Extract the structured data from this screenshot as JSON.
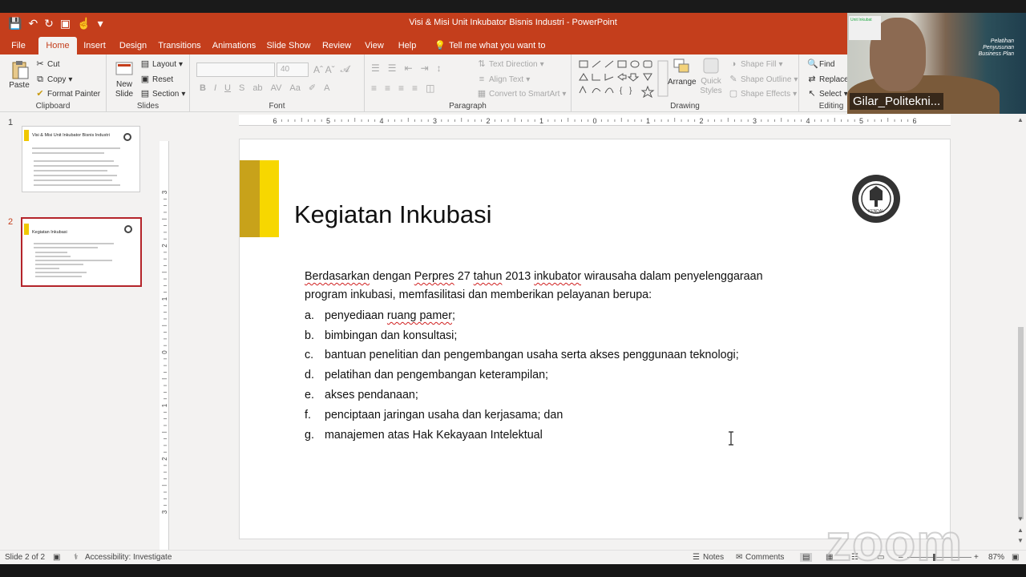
{
  "window": {
    "title": "Visi & Misi Unit Inkubator Bisnis Industri  -  PowerPoint"
  },
  "tabs": [
    {
      "label": "File"
    },
    {
      "label": "Home"
    },
    {
      "label": "Insert"
    },
    {
      "label": "Design"
    },
    {
      "label": "Transitions"
    },
    {
      "label": "Animations"
    },
    {
      "label": "Slide Show"
    },
    {
      "label": "Review"
    },
    {
      "label": "View"
    },
    {
      "label": "Help"
    }
  ],
  "tell_me": "Tell me what you want to do",
  "ribbon": {
    "clipboard": {
      "paste": "Paste",
      "cut": "Cut",
      "copy": "Copy",
      "format_painter": "Format Painter",
      "label": "Clipboard"
    },
    "slides": {
      "new_slide": "New",
      "new_slide2": "Slide",
      "layout": "Layout",
      "reset": "Reset",
      "section": "Section",
      "label": "Slides"
    },
    "font": {
      "size": "40",
      "label": "Font"
    },
    "paragraph": {
      "text_direction": "Text Direction",
      "align_text": "Align Text",
      "convert_smartart": "Convert to SmartArt",
      "label": "Paragraph"
    },
    "drawing": {
      "arrange": "Arrange",
      "quick_styles": "Quick",
      "quick_styles2": "Styles",
      "shape_fill": "Shape Fill",
      "shape_outline": "Shape Outline",
      "shape_effects": "Shape Effects",
      "label": "Drawing"
    },
    "editing": {
      "find": "Find",
      "replace": "Replace",
      "select": "Select",
      "label": "Editing"
    }
  },
  "thumbnails": [
    {
      "number": "1",
      "title": "Visi & Misi Unit Inkubator Bisnis Industri"
    },
    {
      "number": "2",
      "title": "Kegiatan Inkubasi"
    }
  ],
  "ruler": {
    "h_labels": [
      "6",
      "5",
      "4",
      "3",
      "2",
      "1",
      "0",
      "1",
      "2",
      "3",
      "4",
      "5",
      "6"
    ],
    "v_labels": [
      "3",
      "2",
      "1",
      "0",
      "1",
      "2",
      "3"
    ]
  },
  "slide": {
    "title": "Kegiatan Inkubasi",
    "intro_words": [
      "Berdasarkan",
      " dengan ",
      "Perpres",
      " 27 ",
      "tahun",
      " 2013 ",
      "inkubator",
      " wirausaha dalam penyelenggaraan"
    ],
    "intro_line2": "program inkubasi, memfasilitasi dan memberikan pelayanan berupa:",
    "items": [
      {
        "marker": "a.",
        "text_pre": "penyediaan ",
        "text_spell": "ruang pamer",
        "text_post": ";"
      },
      {
        "marker": "b.",
        "text": "bimbingan dan konsultasi;"
      },
      {
        "marker": "c.",
        "text": "bantuan penelitian dan pengembangan usaha serta akses penggunaan teknologi;"
      },
      {
        "marker": "d.",
        "text": "pelatihan dan pengembangan keterampilan;"
      },
      {
        "marker": "e.",
        "text": "akses pendanaan;"
      },
      {
        "marker": "f.",
        "text": "penciptaan jaringan usaha dan kerjasama; dan"
      },
      {
        "marker": "g.",
        "text": "manajemen atas Hak Kekayaan Intelektual"
      }
    ],
    "logo_text": "KENDAL"
  },
  "status": {
    "slide_count": "Slide 2 of 2",
    "accessibility": "Accessibility: Investigate",
    "notes": "Notes",
    "comments": "Comments",
    "zoom": "87%"
  },
  "webcam": {
    "name": "Gilar_Politekni...",
    "poster_lines": [
      "Pelatihan",
      "Penyusunan",
      "Business Plan"
    ],
    "poster_small": "Unit Inkubat"
  },
  "watermark": "zoom",
  "colors": {
    "accent": "#c43e1c",
    "slide_bar_dark": "#c8a21a",
    "slide_bar_light": "#f7d700"
  }
}
